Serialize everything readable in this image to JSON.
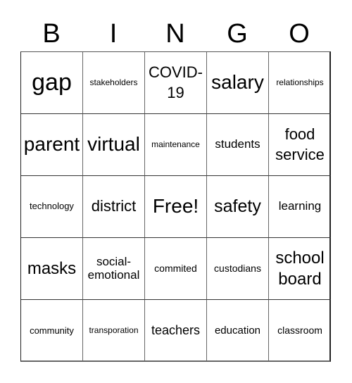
{
  "header": {
    "letters": [
      "B",
      "I",
      "N",
      "G",
      "O"
    ]
  },
  "cells": [
    [
      "gap",
      "stakeholders",
      "COVID-19",
      "salary",
      "relationships"
    ],
    [
      "parent",
      "virtual",
      "maintenance",
      "students",
      "food service"
    ],
    [
      "technology",
      "district",
      "Free!",
      "safety",
      "learning"
    ],
    [
      "masks",
      "social-emotional",
      "commited",
      "custodians",
      "school board"
    ],
    [
      "community",
      "transporation",
      "teachers",
      "education",
      "classroom"
    ]
  ]
}
